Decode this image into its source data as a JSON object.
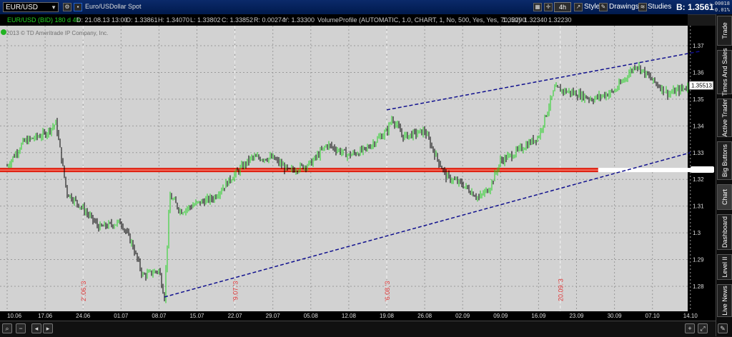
{
  "toolbar": {
    "symbol": "EUR/USD",
    "description": "Euro/USDollar Spot",
    "timeframe": "4h",
    "style_label": "Style",
    "drawings_label": "Drawings",
    "studies_label": "Studies",
    "bid_label": "B: 1.3561",
    "change_top": "-.00018",
    "change_bottom": "-0.01%"
  },
  "infobar": {
    "title": "EUR/USD (BID) 180 d 4h",
    "date": "D: 21.08.13 13:00",
    "open": "O: 1.33861",
    "high": "H: 1.34070",
    "low": "L: 1.33802",
    "close": "C: 1.33852",
    "rate": "R: 0.00274",
    "y": "Y: 1.33300",
    "study": "VolumeProfile (AUTOMATIC, 1.0, CHART, 1, No, 500, Yes, Yes, 70, 50)",
    "vp1": "1.32290",
    "vp2": "1.32340",
    "vp3": "1.32230"
  },
  "watermark": "2013 © TD Ameritrade IP Company, Inc.",
  "sidebar": {
    "tabs": [
      "Trade",
      "Times And Sales",
      "Active Trader",
      "Big Buttons",
      "Chart",
      "Dashboard",
      "Level II",
      "Live News"
    ]
  },
  "bottombar": {
    "icons": [
      "magnifier-icon",
      "zoom-out-icon",
      "scroll-left-icon",
      "scroll-right-icon",
      "zoom-in-icon",
      "expand-icon",
      "drawing-tools-icon",
      "settings-icon"
    ]
  },
  "colors": {
    "background": "#d2d2d2",
    "grid": "#9a9a9a",
    "candle_up": "#22d422",
    "candle_down": "#000000",
    "trendline": "#10108e",
    "resistance": "#e02010",
    "date_marker": "#e03a3a"
  },
  "chart_data": {
    "type": "candlestick",
    "symbol": "EUR/USD",
    "interval": "4h",
    "ylim": [
      1.27,
      1.37
    ],
    "y_ticks": [
      1.28,
      1.29,
      1.3,
      1.31,
      1.32,
      1.33,
      1.34,
      1.35,
      1.36,
      1.37
    ],
    "x_ticks": [
      "10.06",
      "17.06",
      "24.06",
      "01.07",
      "08.07",
      "15.07",
      "22.07",
      "29.07",
      "05.08",
      "12.08",
      "19.08",
      "26.08",
      "02.09",
      "09.09",
      "16.09",
      "23.09",
      "30.09",
      "07.10",
      "14.10"
    ],
    "month_markers": [
      {
        "label": "2'.06.'3",
        "x": "24.06"
      },
      {
        "label": "'9.07.'3",
        "x": "22.07"
      },
      {
        "label": "'6.08.'3",
        "x": "19.08"
      },
      {
        "label": "20.09.'3",
        "x": "20.09"
      }
    ],
    "last_price": "1.35513",
    "close_path": [
      [
        "10.06",
        1.325
      ],
      [
        "13.06",
        1.334
      ],
      [
        "17.06",
        1.337
      ],
      [
        "19.06",
        1.341
      ],
      [
        "21.06",
        1.315
      ],
      [
        "24.06",
        1.309
      ],
      [
        "27.06",
        1.302
      ],
      [
        "01.07",
        1.304
      ],
      [
        "03.07",
        1.296
      ],
      [
        "05.07",
        1.284
      ],
      [
        "08.07",
        1.286
      ],
      [
        "09.07",
        1.276
      ],
      [
        "10.07",
        1.314
      ],
      [
        "12.07",
        1.308
      ],
      [
        "15.07",
        1.311
      ],
      [
        "18.07",
        1.313
      ],
      [
        "22.07",
        1.322
      ],
      [
        "25.07",
        1.328
      ],
      [
        "29.07",
        1.328
      ],
      [
        "01.08",
        1.323
      ],
      [
        "05.08",
        1.326
      ],
      [
        "08.08",
        1.333
      ],
      [
        "12.08",
        1.329
      ],
      [
        "15.08",
        1.331
      ],
      [
        "19.08",
        1.338
      ],
      [
        "20.08",
        1.343
      ],
      [
        "22.08",
        1.336
      ],
      [
        "26.08",
        1.338
      ],
      [
        "28.08",
        1.329
      ],
      [
        "30.08",
        1.321
      ],
      [
        "02.09",
        1.318
      ],
      [
        "05.09",
        1.313
      ],
      [
        "07.09",
        1.317
      ],
      [
        "09.09",
        1.327
      ],
      [
        "11.09",
        1.329
      ],
      [
        "16.09",
        1.336
      ],
      [
        "19.09",
        1.354
      ],
      [
        "23.09",
        1.352
      ],
      [
        "26.09",
        1.35
      ],
      [
        "30.09",
        1.353
      ],
      [
        "04.10",
        1.363
      ],
      [
        "07.10",
        1.357
      ],
      [
        "10.10",
        1.352
      ],
      [
        "14.10",
        1.355
      ]
    ],
    "lines": [
      {
        "name": "upper-trendline",
        "style": "dashed",
        "from": [
          "19.08",
          1.346
        ],
        "to": [
          "16.10",
          1.368
        ]
      },
      {
        "name": "lower-trendline",
        "style": "dashed",
        "from": [
          "09.07",
          1.276
        ],
        "to": [
          "14.10",
          1.33
        ]
      },
      {
        "name": "horizontal-level",
        "style": "solid",
        "price": 1.3235,
        "from": "10.06",
        "to": "14.10"
      }
    ]
  }
}
